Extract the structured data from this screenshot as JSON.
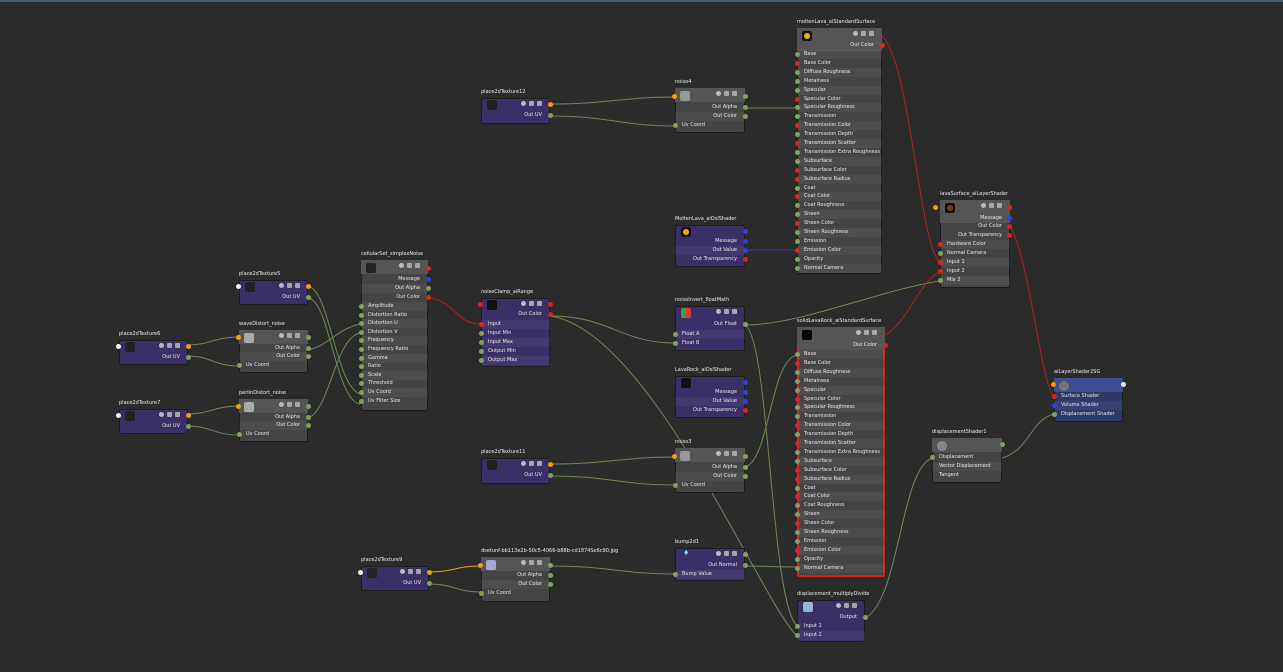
{
  "window": {
    "title": "Hypershade - Node Editor"
  },
  "nodes": {
    "moltenLava": {
      "title": "moltenLava_aiStandardSurface",
      "out": "Out Color",
      "inputs": [
        "Base",
        "Base Color",
        "Diffuse Roughness",
        "Metalness",
        "Specular",
        "Specular Color",
        "Specular Roughness",
        "Transmission",
        "Transmission Color",
        "Transmission Depth",
        "Transmission Scatter",
        "Transmission Extra Roughness",
        "Subsurface",
        "Subsurface Color",
        "Subsurface Radius",
        "Coat",
        "Coat Color",
        "Coat Roughness",
        "Sheen",
        "Sheen Color",
        "Sheen Roughness",
        "Emission",
        "Emission Color",
        "Opacity",
        "Normal Camera"
      ]
    },
    "solidLavaRock": {
      "title": "solidLavaRock_aiStandardSurface",
      "out": "Out Color",
      "inputs": [
        "Base",
        "Base Color",
        "Diffuse Roughness",
        "Metalness",
        "Specular",
        "Specular Color",
        "Specular Roughness",
        "Transmission",
        "Transmission Color",
        "Transmission Depth",
        "Transmission Scatter",
        "Transmission Extra Roughness",
        "Subsurface",
        "Subsurface Color",
        "Subsurface Radius",
        "Coat",
        "Coat Color",
        "Coat Roughness",
        "Sheen",
        "Sheen Color",
        "Sheen Roughness",
        "Emission",
        "Emission Color",
        "Opacity",
        "Normal Camera"
      ]
    },
    "lavaSurface": {
      "title": "lavaSurface_aiLayerShader",
      "outs": [
        "Message",
        "Out Color",
        "Out Transparency"
      ],
      "inputs": [
        "Hardware Color",
        "Normal Camera",
        "Input 1",
        "Input 2",
        "Mix 2"
      ]
    },
    "aiLayerSG": {
      "title": "aiLayerShader2SG",
      "inputs": [
        "Surface Shader",
        "Volume Shader",
        "Displacement Shader"
      ]
    },
    "displacementShader1": {
      "title": "displacementShader1",
      "inputs": [
        "Displacement",
        "Vector Displacement",
        "Tangent"
      ]
    },
    "noise4": {
      "title": "noise4",
      "outs": [
        "Out Alpha",
        "Out Color"
      ],
      "inputs": [
        "Uv Coord"
      ]
    },
    "noise3": {
      "title": "noise3",
      "outs": [
        "Out Alpha",
        "Out Color"
      ],
      "inputs": [
        "Uv Coord"
      ]
    },
    "place12": {
      "title": "place2dTexture12",
      "outs": [
        "Out UV"
      ]
    },
    "place11": {
      "title": "place2dTexture11",
      "outs": [
        "Out UV"
      ]
    },
    "place5": {
      "title": "place2dTexture5",
      "outs": [
        "Out UV"
      ]
    },
    "place6": {
      "title": "place2dTexture6",
      "outs": [
        "Out UV"
      ]
    },
    "place7": {
      "title": "place2dTexture7",
      "outs": [
        "Out UV"
      ]
    },
    "place9": {
      "title": "place2dTexture9",
      "outs": [
        "Out UV"
      ]
    },
    "waveDistort": {
      "title": "waveDistort_noise",
      "outs": [
        "Out Alpha",
        "Out Color"
      ],
      "inputs": [
        "Uv Coord"
      ]
    },
    "perlinDistort": {
      "title": "perlinDistort_noise",
      "outs": [
        "Out Alpha",
        "Out Color"
      ],
      "inputs": [
        "Uv Coord"
      ]
    },
    "cellular": {
      "title": "cellularSet_simplexNoise",
      "outs": [
        "Message",
        "Out Alpha",
        "Out Color"
      ],
      "inputs": [
        "Amplitude",
        "Distortion Ratio",
        "Distortion U",
        "Distortion V",
        "Frequency",
        "Frequency Ratio",
        "Gamma",
        "Ratio",
        "Scale",
        "Threshold",
        "Uv Coord",
        "Uv Filter Size"
      ]
    },
    "noiseClamp": {
      "title": "noiseClamp_aiRange",
      "out": "Out Color",
      "inputs": [
        "Input",
        "Input Min",
        "Input Max",
        "Output Min",
        "Output Max"
      ]
    },
    "moltenOsl": {
      "title": "MoltenLava_aiOslShader",
      "outs": [
        "Message",
        "Out Value",
        "Out Transparency"
      ]
    },
    "lavaOsl": {
      "title": "LavaRock_aiOslShader",
      "outs": [
        "Message",
        "Out Value",
        "Out Transparency"
      ]
    },
    "noiseInvert": {
      "title": "noiseInvert_floatMath",
      "out": "Out Float",
      "inputs": [
        "Float A",
        "Float B"
      ]
    },
    "dsetTex": {
      "title": "dsetunf-bb113e2b-50c5-4066-b88b-cd1874Se6c90.jpg",
      "outs": [
        "Out Alpha",
        "Out Color"
      ],
      "inputs": [
        "Uv Coord"
      ]
    },
    "bump": {
      "title": "bump2d1",
      "out": "Out Normal",
      "inputs": [
        "Bump Value"
      ]
    },
    "dispMul": {
      "title": "displacement_multiplyDivide",
      "out": "Output",
      "inputs": [
        "Input 1",
        "Input 2"
      ]
    }
  },
  "icons": [
    "place2d-icon",
    "noise-icon",
    "shader-sphere-icon",
    "float-math-icon",
    "file-texture-icon",
    "bump-icon",
    "multiply-divide-icon",
    "shading-group-icon"
  ],
  "colors": {
    "background": "#2b2b2b",
    "wire_green": "#6e8a55",
    "wire_red": "#b3231c",
    "selected": "#d42020",
    "port_red": "#d6271f",
    "port_blue": "#3040e0",
    "port_orange": "#f1a108"
  }
}
